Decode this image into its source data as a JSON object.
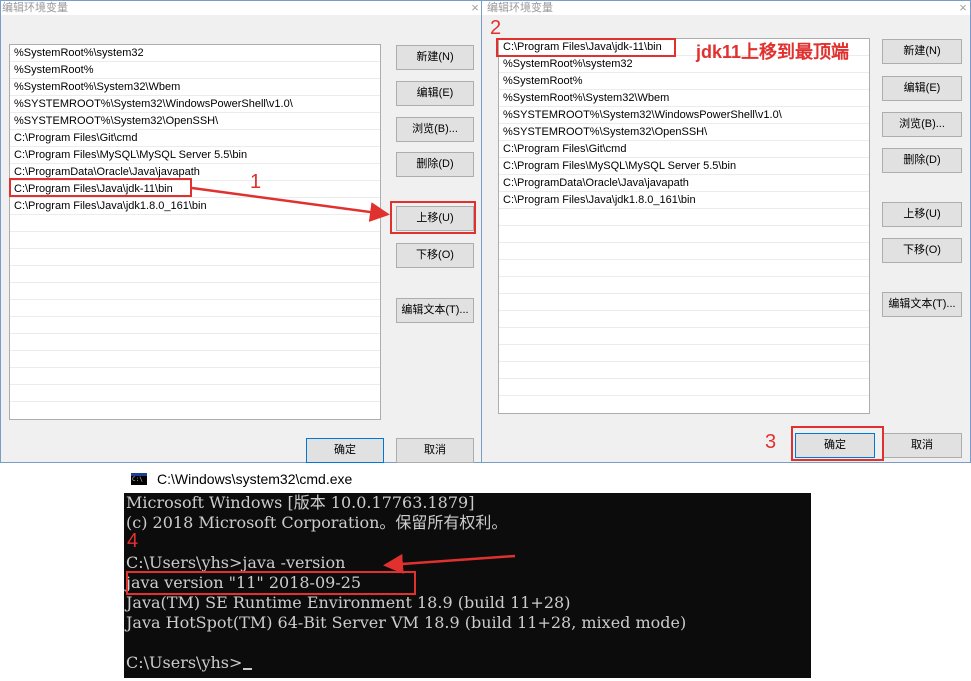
{
  "left_dialog": {
    "title": "编辑环境变量",
    "close": "×",
    "path_entries": [
      "%SystemRoot%\\system32",
      "%SystemRoot%",
      "%SystemRoot%\\System32\\Wbem",
      "%SYSTEMROOT%\\System32\\WindowsPowerShell\\v1.0\\",
      "%SYSTEMROOT%\\System32\\OpenSSH\\",
      "C:\\Program Files\\Git\\cmd",
      "C:\\Program Files\\MySQL\\MySQL Server 5.5\\bin",
      "C:\\ProgramData\\Oracle\\Java\\javapath",
      "C:\\Program Files\\Java\\jdk-11\\bin",
      "C:\\Program Files\\Java\\jdk1.8.0_161\\bin"
    ],
    "buttons": {
      "new": "新建(N)",
      "edit": "编辑(E)",
      "browse": "浏览(B)...",
      "delete": "删除(D)",
      "move_up": "上移(U)",
      "move_down": "下移(O)",
      "edit_text": "编辑文本(T)...",
      "ok": "确定",
      "cancel": "取消"
    }
  },
  "right_dialog": {
    "title": "编辑环境变量",
    "close": "×",
    "path_entries": [
      "C:\\Program Files\\Java\\jdk-11\\bin",
      "%SystemRoot%\\system32",
      "%SystemRoot%",
      "%SystemRoot%\\System32\\Wbem",
      "%SYSTEMROOT%\\System32\\WindowsPowerShell\\v1.0\\",
      "%SYSTEMROOT%\\System32\\OpenSSH\\",
      "C:\\Program Files\\Git\\cmd",
      "C:\\Program Files\\MySQL\\MySQL Server 5.5\\bin",
      "C:\\ProgramData\\Oracle\\Java\\javapath",
      "C:\\Program Files\\Java\\jdk1.8.0_161\\bin"
    ],
    "buttons": {
      "new": "新建(N)",
      "edit": "编辑(E)",
      "browse": "浏览(B)...",
      "delete": "删除(D)",
      "move_up": "上移(U)",
      "move_down": "下移(O)",
      "edit_text": "编辑文本(T)...",
      "ok": "确定",
      "cancel": "取消"
    }
  },
  "annotations": {
    "step1": "1",
    "step2": "2",
    "step3": "3",
    "step4": "4",
    "note": "jdk11上移到最顶端",
    "color": "#e0312f"
  },
  "cmd": {
    "title": "C:\\Windows\\system32\\cmd.exe",
    "icon_label": "C:\\",
    "lines": [
      "Microsoft Windows [版本 10.0.17763.1879]",
      "(c) 2018 Microsoft Corporation。保留所有权利。",
      "",
      "C:\\Users\\yhs>java -version",
      "java version \"11\" 2018-09-25",
      "Java(TM) SE Runtime Environment 18.9 (build 11+28)",
      "Java HotSpot(TM) 64-Bit Server VM 18.9 (build 11+28, mixed mode)",
      "",
      "C:\\Users\\yhs>"
    ]
  },
  "colors": {
    "dialog_bg": "#f0f0f0",
    "cmd_bg": "#0c0c0c",
    "cmd_text": "#cccccc",
    "annotation_red": "#e0312f"
  }
}
